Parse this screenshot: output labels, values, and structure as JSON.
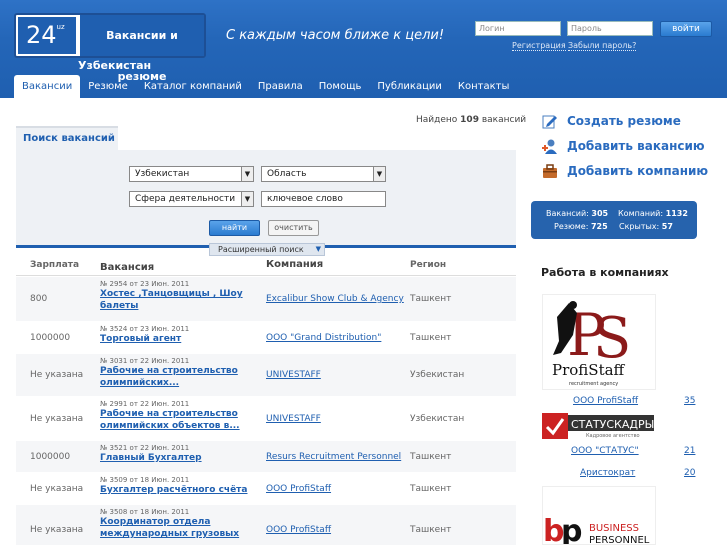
{
  "header": {
    "logo_number": "24",
    "logo_sup": "uz",
    "logo_title": "Вакансии и резюме",
    "country": "Узбекистан",
    "slogan": "С каждым часом ближе к цели!",
    "login_placeholder": "Логин",
    "password_placeholder": "Пароль",
    "login_button": "войти",
    "register_link": "Регистрация",
    "forgot_link": "Забыли пароль?"
  },
  "nav": [
    "Вакансии",
    "Резюме",
    "Каталог компаний",
    "Правила",
    "Помощь",
    "Публикации",
    "Контакты"
  ],
  "search": {
    "found_prefix": "Найдено",
    "found_count": "109",
    "found_suffix": "вакансий",
    "tab_label": "Поиск вакансий",
    "country_value": "Узбекистан",
    "region_value": "Область",
    "sphere_value": "Сфера деятельности",
    "keyword_value": "ключевое слово",
    "find_button": "найти",
    "clear_button": "очистить",
    "advanced": "Расширенный поиск"
  },
  "table": {
    "headers": [
      "Зарплата",
      "Вакансия",
      "Компания",
      "Регион"
    ],
    "rows": [
      {
        "salary": "800",
        "meta": "№ 2954 от 23 Июн. 2011",
        "title": "Хостес ,Танцовщицы , Шоу балеты",
        "company": "Excalibur Show Club & Agency",
        "region": "Ташкент"
      },
      {
        "salary": "1000000",
        "meta": "№ 3524 от 23 Июн. 2011",
        "title": "Торговый агент",
        "company": "ООО \"Grand Distribution\"",
        "region": "Ташкент"
      },
      {
        "salary": "Не указана",
        "meta": "№ 3031 от 22 Июн. 2011",
        "title": "Рабочие на строительство олимпийских...",
        "company": "UNIVESTAFF",
        "region": "Узбекистан"
      },
      {
        "salary": "Не указана",
        "meta": "№ 2991 от 22 Июн. 2011",
        "title": "Рабочие на строительство олимпийских объектов в...",
        "company": "UNIVESTAFF",
        "region": "Узбекистан"
      },
      {
        "salary": "1000000",
        "meta": "№ 3521 от 22 Июн. 2011",
        "title": "Главный Бухгалтер",
        "company": "Resurs Recruitment Personnel",
        "region": "Ташкент"
      },
      {
        "salary": "Не указана",
        "meta": "№ 3509 от 18 Июн. 2011",
        "title": "Бухгалтер расчётного счёта",
        "company": "ООО ProfiStaff",
        "region": "Ташкент"
      },
      {
        "salary": "Не указана",
        "meta": "№ 3508 от 18 Июн. 2011",
        "title": "Координатор отдела международных грузовых",
        "company": "ООО ProfiStaff",
        "region": "Ташкент"
      }
    ]
  },
  "sidebar": {
    "create_resume": "Создать резюме",
    "add_vacancy": "Добавить вакансию",
    "add_company": "Добавить компанию",
    "stats": {
      "vacancies_label": "Вакансий:",
      "vacancies": "305",
      "companies_label": "Компаний:",
      "companies": "1132",
      "resumes_label": "Резюме:",
      "resumes": "725",
      "hidden_label": "Скрытых:",
      "hidden": "57"
    },
    "companies_title": "Работа в компаниях",
    "logo_profi_main": "ProfiStaff",
    "logo_profi_sub": "recruitment agency",
    "logo_status_main": "СТАТУСКАДРЫ",
    "logo_status_sub": "Кадровое агентство",
    "logo_bp_main": "BUSINESS",
    "logo_bp_sub": "PERSONNEL",
    "companies": [
      {
        "name": "ООО ProfiStaff",
        "count": "35"
      },
      {
        "name": "ООО \"СТАТУС\"",
        "count": "21"
      },
      {
        "name": "Аристократ",
        "count": "20"
      }
    ]
  }
}
